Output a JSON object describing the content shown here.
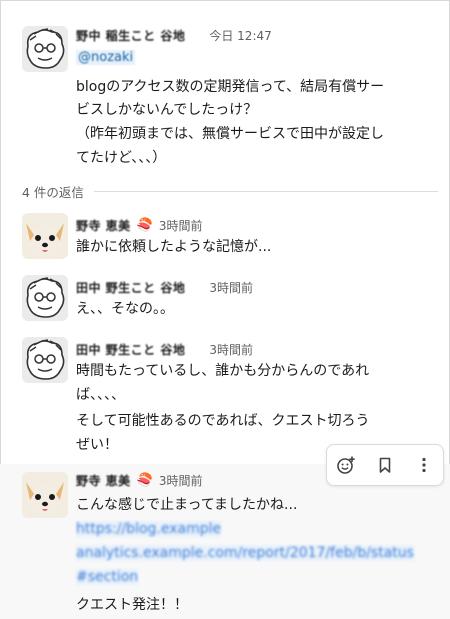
{
  "parent": {
    "sender": "野中 稲生こと 谷地",
    "time": "今日 12:47",
    "mention": "@nozaki",
    "lines": [
      "blogのアクセス数の定期発信って、結局有償サー",
      "ビスしかないんでしたっけ？",
      "（昨年初頭までは、無償サービスで田中が設定し",
      "てたけど、、、）"
    ]
  },
  "replies_label": "4 件の返信",
  "replies": [
    {
      "sender": "野寺 恵美",
      "emoji": "🍣",
      "time": "3時間前",
      "lines": [
        "誰かに依頼したような記憶が..."
      ]
    },
    {
      "sender": "田中 野生こと 谷地",
      "time": "3時間前",
      "lines": [
        "え、、そなの。。"
      ]
    },
    {
      "sender": "田中 野生こと 谷地",
      "time": "3時間前",
      "lines": [
        "時間もたっているし、誰かも分からんのであれ",
        "ば、、、、",
        "そして可能性あるのであれば、クエスト切ろう",
        "ぜい！"
      ]
    },
    {
      "sender": "野寺 恵美",
      "emoji": "🍣",
      "time": "3時間前",
      "lines": [
        "こんな感じで止まってましたかね..."
      ],
      "link_lines": [
        "https://blog.example",
        "analytics.example.com/report/2017/feb/b/status",
        "#section"
      ],
      "after_link": "クエスト発注！！"
    }
  ],
  "toolbar": {
    "react_icon": "add-reaction-icon",
    "bookmark_icon": "bookmark-icon",
    "more_icon": "more-vertical-icon"
  },
  "colors": {
    "link": "#3b7dd8",
    "muted": "#616061",
    "hover_bg": "#f8f8f8"
  }
}
